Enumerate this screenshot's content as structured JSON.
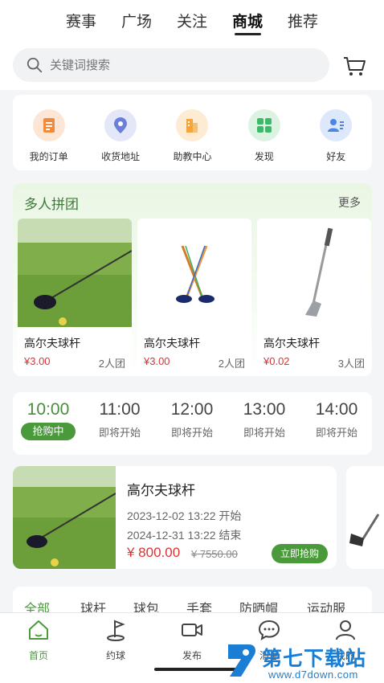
{
  "top_tabs": [
    "赛事",
    "广场",
    "关注",
    "商城",
    "推荐"
  ],
  "active_tab_index": 3,
  "search": {
    "placeholder": "关键词搜索"
  },
  "quick_menu": [
    {
      "label": "我的订单",
      "icon": "order-icon",
      "color": "#f28a3c"
    },
    {
      "label": "收货地址",
      "icon": "location-icon",
      "color": "#6a7fd8"
    },
    {
      "label": "助教中心",
      "icon": "building-icon",
      "color": "#f2a63c"
    },
    {
      "label": "发现",
      "icon": "grid-icon",
      "color": "#3cba6a"
    },
    {
      "label": "好友",
      "icon": "friends-icon",
      "color": "#4a86e8"
    }
  ],
  "group_buy": {
    "title": "多人拼团",
    "more": "更多",
    "items": [
      {
        "name": "高尔夫球杆",
        "price": "¥3.00",
        "team": "2人团"
      },
      {
        "name": "高尔夫球杆",
        "price": "¥3.00",
        "team": "2人团"
      },
      {
        "name": "高尔夫球杆",
        "price": "¥0.02",
        "team": "3人团"
      }
    ]
  },
  "time_slots": [
    {
      "time": "10:00",
      "status": "抢购中"
    },
    {
      "time": "11:00",
      "status": "即将开始"
    },
    {
      "time": "12:00",
      "status": "即将开始"
    },
    {
      "time": "13:00",
      "status": "即将开始"
    },
    {
      "time": "14:00",
      "status": "即将开始"
    }
  ],
  "flash_sale": {
    "name": "高尔夫球杆",
    "start": "2023-12-02 13:22  开始",
    "end": "2024-12-31 13:22  结束",
    "price": "¥ 800.00",
    "original_price": "¥ 7550.00",
    "buy_label": "立即抢购"
  },
  "categories": [
    "全部",
    "球杆",
    "球包",
    "手套",
    "防晒帽",
    "运动服"
  ],
  "bottom_nav": [
    {
      "label": "首页",
      "icon": "home-icon"
    },
    {
      "label": "约球",
      "icon": "golf-flag-icon"
    },
    {
      "label": "发布",
      "icon": "video-icon"
    },
    {
      "label": "消息",
      "icon": "message-icon"
    },
    {
      "label": "我的",
      "icon": "user-icon"
    }
  ],
  "watermark": {
    "text": "第七下载站",
    "url": "www.d7down.com"
  },
  "colors": {
    "accent": "#4a9a3c",
    "price": "#dd3333"
  }
}
